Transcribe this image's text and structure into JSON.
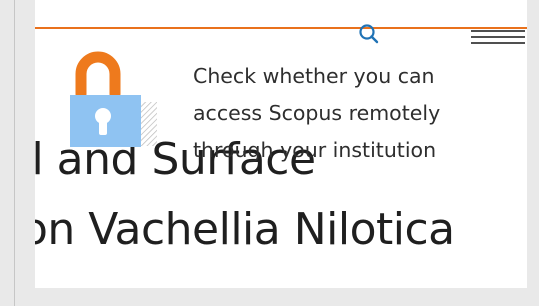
{
  "article": {
    "title_line1": "al and Surface",
    "title_line2": "on Vachellia Nilotica"
  },
  "access_popup": {
    "line1": "Check whether you can",
    "line2": "access Scopus remotely",
    "line3": "through your institution",
    "lock_icon": "unlocked-padlock-icon"
  },
  "header": {
    "search_icon": "search-icon",
    "menu_icon": "hamburger-menu-icon"
  },
  "colors": {
    "accent": "#e9711c",
    "lock_body": "#8fc3f2",
    "text": "#2e2e2e"
  }
}
